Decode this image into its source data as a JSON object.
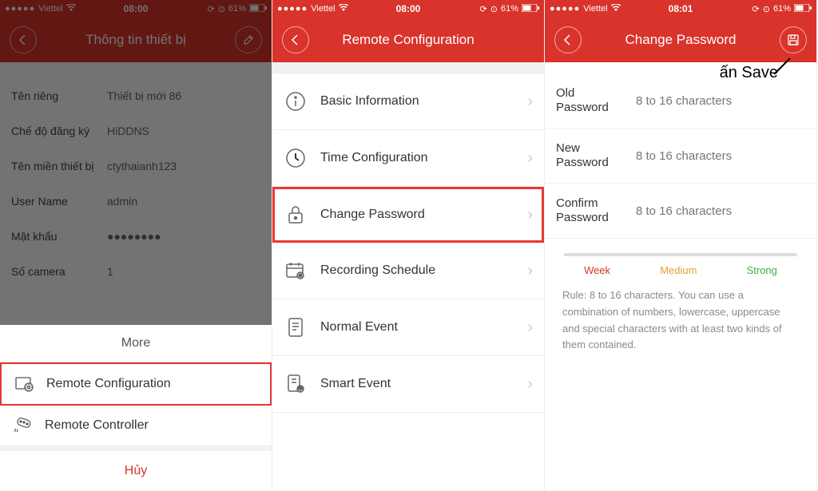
{
  "status": {
    "carrier": "Viettel",
    "time1": "08:00",
    "time2": "08:00",
    "time3": "08:01",
    "battery": "61%",
    "dots": "●●●●●"
  },
  "screen1": {
    "title": "Thông tin thiết bị",
    "fields": [
      {
        "label": "Tên riêng",
        "value": "Thiết bị mới 86"
      },
      {
        "label": "Chế độ đăng ký",
        "value": "HiDDNS"
      },
      {
        "label": "Tên miền thiết bị",
        "value": "ctythaianh123"
      },
      {
        "label": "User Name",
        "value": "admin"
      },
      {
        "label": "Mật khẩu",
        "value": "●●●●●●●●"
      },
      {
        "label": "Số camera",
        "value": "1"
      }
    ],
    "sheet": {
      "title": "More",
      "item1": "Remote Configuration",
      "item2": "Remote Controller",
      "cancel": "Hủy"
    }
  },
  "screen2": {
    "title": "Remote Configuration",
    "items": {
      "basic": "Basic Information",
      "time": "Time Configuration",
      "password": "Change Password",
      "recording": "Recording Schedule",
      "normal": "Normal Event",
      "smart": "Smart Event"
    }
  },
  "screen3": {
    "title": "Change Password",
    "annotation": "ấn Save",
    "old": "Old Password",
    "new": "New Password",
    "confirm": "Confirm Password",
    "placeholder": "8 to 16 characters",
    "strength": {
      "weak": "Week",
      "medium": "Medium",
      "strong": "Strong"
    },
    "rule": "Rule: 8 to 16 characters. You can use a combination of numbers, lowercase, uppercase and special characters with at least two kinds of them contained."
  }
}
